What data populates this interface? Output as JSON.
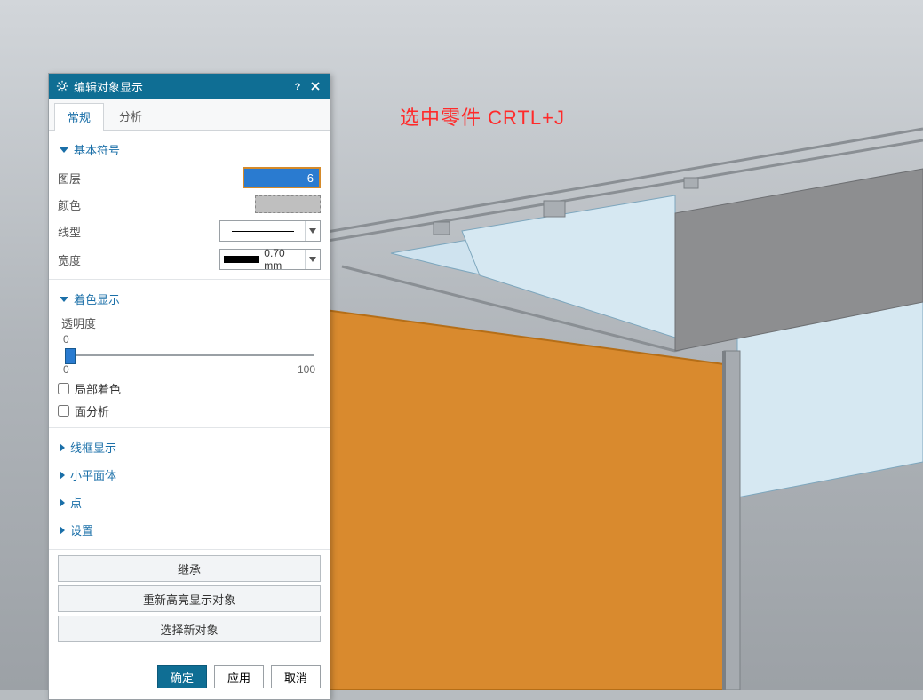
{
  "annotation": "选中零件 CRTL+J",
  "dialog": {
    "title": "编辑对象显示",
    "tabs": {
      "general": "常规",
      "analysis": "分析"
    },
    "sections": {
      "basic_symbol": "基本符号",
      "shaded_display": "着色显示",
      "wireframe": "线框显示",
      "facet": "小平面体",
      "point": "点",
      "settings": "设置"
    },
    "fields": {
      "layer_label": "图层",
      "layer_value": "6",
      "color_label": "颜色",
      "linetype_label": "线型",
      "width_label": "宽度",
      "width_value": "0.70 mm",
      "transparency_label": "透明度",
      "transparency_tick": "0",
      "transparency_min": "0",
      "transparency_max": "100",
      "local_shading_label": "局部着色",
      "face_analysis_label": "面分析"
    },
    "buttons": {
      "inherit": "继承",
      "rehighlight": "重新高亮显示对象",
      "select_new": "选择新对象",
      "ok": "确定",
      "apply": "应用",
      "cancel": "取消"
    }
  }
}
